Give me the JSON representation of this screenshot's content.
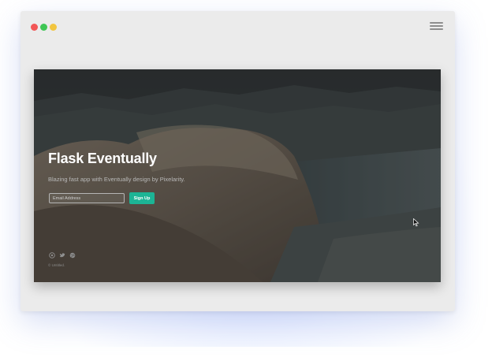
{
  "window": {
    "controls": [
      "close",
      "minimize",
      "maximize"
    ],
    "colors": {
      "close": "#f25656",
      "minimize": "#3fc655",
      "maximize": "#f2c53f"
    },
    "menu_icon": "hamburger-icon"
  },
  "hero": {
    "title": "Flask Eventually",
    "subtitle": "Blazing fast app with Eventually design by Pixelarity.",
    "email_placeholder": "Email Address",
    "signup_label": "Sign Up",
    "accent_color": "#1cb495",
    "social_icons": [
      "github-icon",
      "twitter-icon",
      "dribbble-icon"
    ],
    "copyright": "© Untitled."
  }
}
